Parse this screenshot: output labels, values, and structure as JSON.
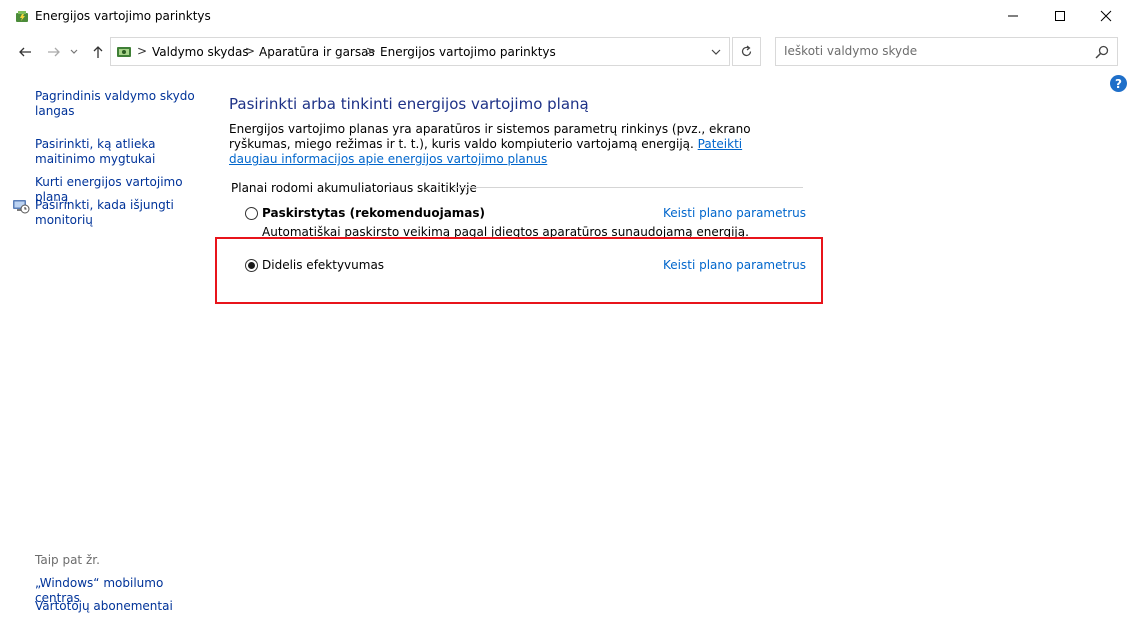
{
  "window": {
    "title": "Energijos vartojimo parinktys"
  },
  "address": {
    "crumbs": [
      "Valdymo skydas",
      "Aparatūra ir garsas",
      "Energijos vartojimo parinktys"
    ],
    "separator": ">"
  },
  "search": {
    "placeholder": "Ieškoti valdymo skyde"
  },
  "help": {
    "label": "?"
  },
  "sidebar": {
    "links": [
      "Pagrindinis valdymo skydo langas",
      "Pasirinkti, ką atlieka maitinimo mygtukai",
      "Kurti energijos vartojimo planą",
      "Pasirinkti, kada išjungti monitorių"
    ],
    "see_also_label": "Taip pat žr.",
    "see_also": [
      "„Windows“ mobilumo centras",
      "Vartotojų abonementai"
    ]
  },
  "main": {
    "title": "Pasirinkti arba tinkinti energijos vartojimo planą",
    "description": "Energijos vartojimo planas yra aparatūros ir sistemos parametrų rinkinys (pvz., ekrano ryškumas, miego režimas ir t. t.), kuris valdo kompiuterio vartojamą energiją. ",
    "description_link": "Pateikti daugiau informacijos apie energijos vartojimo planus",
    "group_label": "Planai rodomi akumuliatoriaus skaitiklyje",
    "plans": [
      {
        "name": "Paskirstytas (rekomenduojamas)",
        "description": "Automatiškai paskirsto veikimą pagal įdiegtos aparatūros sunaudojamą energiją.",
        "link": "Keisti plano parametrus",
        "selected": false
      },
      {
        "name": "Didelis efektyvumas",
        "link": "Keisti plano parametrus",
        "selected": true
      }
    ]
  },
  "colors": {
    "link": "#0066cc",
    "sidebar_link": "#003399",
    "title": "#1e3287",
    "highlight": "#e8141b"
  }
}
